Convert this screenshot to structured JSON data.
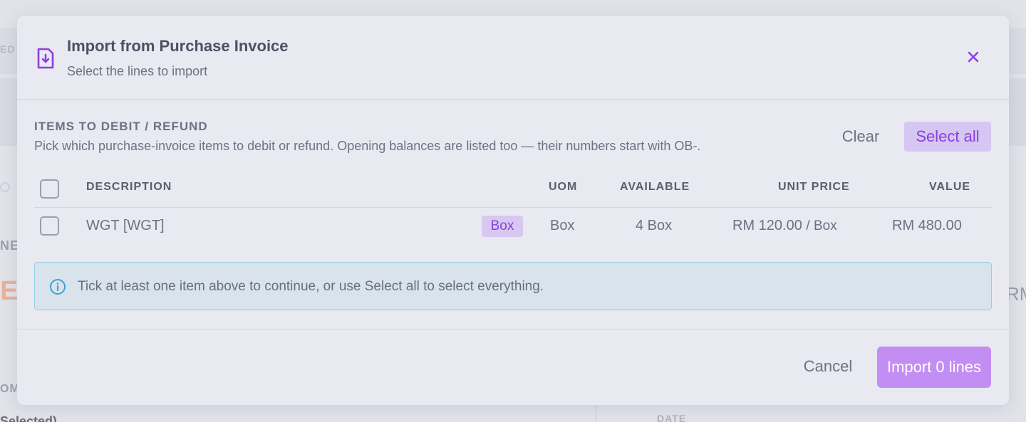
{
  "background": {
    "ed_text": "ED",
    "new_text": "NEV",
    "e_text": "E",
    "rm_text": "RM",
    "om_text": "OM",
    "selected_text": "Selected)",
    "date_text": "DATE"
  },
  "modal": {
    "title": "Import from Purchase Invoice",
    "subtitle": "Select the lines to import",
    "icons": {
      "header": "file-import-icon",
      "close": "close-icon",
      "info": "info-icon"
    },
    "colors": {
      "accent": "#8a3fe0",
      "import_button": "#c38ef3",
      "info_bg": "#d8e3ec",
      "info_border": "#8ecfe6"
    }
  },
  "section": {
    "title": "ITEMS TO DEBIT / REFUND",
    "description": "Pick which purchase-invoice items to debit or refund. Opening balances are listed too — their numbers start with OB-.",
    "clear_label": "Clear",
    "select_all_label": "Select all"
  },
  "table": {
    "headers": {
      "description": "DESCRIPTION",
      "uom": "UOM",
      "available": "AVAILABLE",
      "unit_price": "UNIT PRICE",
      "value": "VALUE"
    },
    "rows": [
      {
        "description": "WGT  [WGT]",
        "badge": "Box",
        "uom": "Box",
        "available": "4 Box",
        "unit_price": "RM 120.00",
        "unit_suffix": "/ Box",
        "value": "RM 480.00",
        "checked": false
      }
    ]
  },
  "info": {
    "message": "Tick at least one item above to continue, or use Select all to select everything."
  },
  "footer": {
    "cancel_label": "Cancel",
    "import_label": "Import 0 lines"
  }
}
